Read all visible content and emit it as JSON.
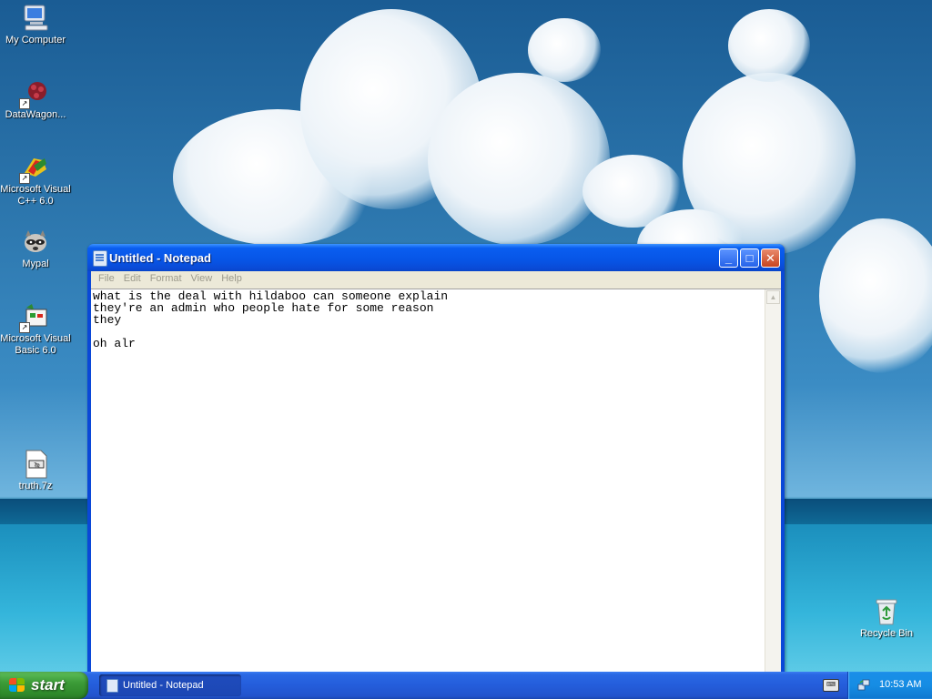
{
  "desktop": {
    "icons": [
      {
        "label": "My Computer"
      },
      {
        "label": "DataWagon..."
      },
      {
        "label": "Microsoft Visual C++ 6.0"
      },
      {
        "label": "Mypal"
      },
      {
        "label": "Microsoft Visual Basic 6.0"
      },
      {
        "label": "truth.7z"
      },
      {
        "label": "Recycle Bin"
      }
    ]
  },
  "notepad": {
    "title": "Untitled - Notepad",
    "menu": [
      "File",
      "Edit",
      "Format",
      "View",
      "Help"
    ],
    "content": "what is the deal with hildaboo can someone explain\nthey're an admin who people hate for some reason\nthey\n\noh alr",
    "buttons": {
      "minimize": "_",
      "maximize": "□",
      "close": "✕"
    }
  },
  "taskbar": {
    "start_label": "start",
    "task_label": "Untitled - Notepad",
    "clock": "10:53 AM"
  }
}
